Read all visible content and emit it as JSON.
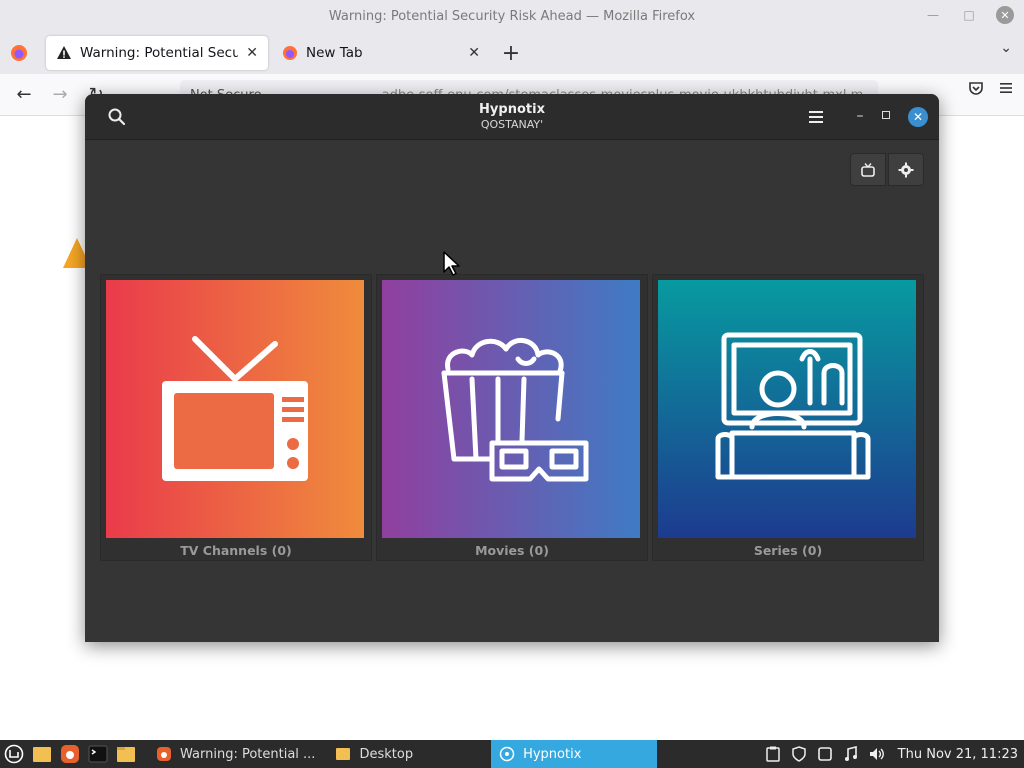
{
  "firefox": {
    "window_title": "Warning: Potential Security Risk Ahead — Mozilla Firefox",
    "tabs": [
      {
        "label": "Warning: Potential Security Risk Ahead",
        "active": true
      },
      {
        "label": "New Tab",
        "active": false
      }
    ],
    "url_security": "Not Secure",
    "url_text": "adbe-soff-enu-com/stemaclasses-moviesplus-movie-ukbkhtubdjvht-mxl.m"
  },
  "hypnotix": {
    "title": "Hypnotix",
    "subtitle": "QOSTANAY'",
    "cards": [
      {
        "label": "TV Channels (0)",
        "icon": "tv-icon"
      },
      {
        "label": "Movies (0)",
        "icon": "popcorn-icon"
      },
      {
        "label": "Series (0)",
        "icon": "series-icon"
      }
    ]
  },
  "taskbar": {
    "items": [
      {
        "label": "Warning: Potential ...",
        "icon": "firefox-icon",
        "active": false
      },
      {
        "label": "Desktop",
        "icon": "folder-icon",
        "active": false
      },
      {
        "label": "Hypnotix",
        "icon": "hypnotix-icon",
        "active": true
      }
    ],
    "clock": "Thu Nov 21, 11:23"
  },
  "colors": {
    "accent": "#35a8e0",
    "hypnotix_bg": "#353535",
    "tv_gradient": [
      "#ea3b4b",
      "#ef8c3c"
    ],
    "movies_gradient": [
      "#913f9e",
      "#3f7bc4"
    ],
    "series_gradient": [
      "#089aa0",
      "#1d3b8f"
    ]
  }
}
